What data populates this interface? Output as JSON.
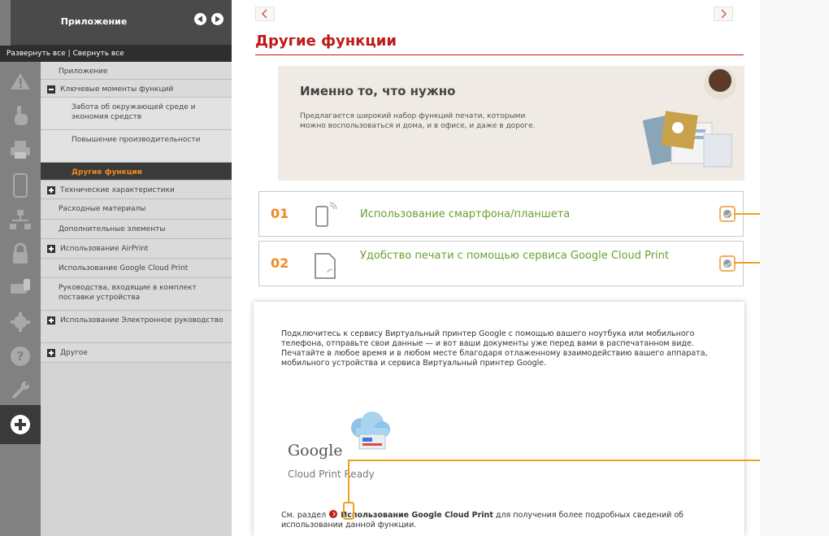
{
  "sidebar": {
    "title": "Приложение",
    "expand_all": "Развернуть все",
    "separator": " | ",
    "collapse_all": "Свернуть все",
    "tree": [
      {
        "label": "Приложение",
        "level": 1,
        "toggle": "none"
      },
      {
        "label": "Ключевые моменты функций",
        "level": 1,
        "toggle": "minus"
      },
      {
        "label": "Забота об окружающей среде и экономия средств",
        "level": 2,
        "toggle": "none"
      },
      {
        "label": "Повышение производительности",
        "level": 2,
        "toggle": "none"
      },
      {
        "label": "Другие функции",
        "level": 2,
        "toggle": "none",
        "selected": true
      },
      {
        "label": "Технические характеристики",
        "level": 1,
        "toggle": "plus"
      },
      {
        "label": "Расходные материалы",
        "level": 1,
        "toggle": "none"
      },
      {
        "label": "Дополнительные элементы",
        "level": 1,
        "toggle": "none"
      },
      {
        "label": "Использование AirPrint",
        "level": 1,
        "toggle": "plus"
      },
      {
        "label": "Использование Google Cloud Print",
        "level": 1,
        "toggle": "none"
      },
      {
        "label": "Руководства, входящие в комплект поставки устройства",
        "level": 1,
        "toggle": "none"
      },
      {
        "label": "Использование Электронное руководство",
        "level": 1,
        "toggle": "plus"
      },
      {
        "label": "Другое",
        "level": 1,
        "toggle": "plus"
      }
    ],
    "icons": [
      "warning-icon",
      "hand-touch-icon",
      "printer-icon",
      "smartphone-icon",
      "network-icon",
      "lock-icon",
      "mobile-print-icon",
      "gear-icon",
      "help-icon",
      "wrench-icon",
      "plus-circle-icon"
    ]
  },
  "main": {
    "title": "Другие функции",
    "banner": {
      "heading": "Именно то, что нужно",
      "text": "Предлагается широкий набор функций печати, которыми можно воспользоваться и дома, и в офисе, и даже в дороге."
    },
    "features": [
      {
        "number": "01",
        "label": "Использование смартфона/планшета",
        "icon": "smartphone-icon",
        "callout": "a"
      },
      {
        "number": "02",
        "label": "Удобство печати с помощью сервиса Google Cloud Print",
        "icon": "cloud-print-document-icon",
        "callout": "a"
      }
    ],
    "panel": {
      "text": "Подключитесь к сервису Виртуальный принтер Google с помощью вашего ноутбука или мобильного телефона, отправьте свои данные — и вот ваши документы уже перед вами в распечатанном виде. Печатайте в любое время и в любом месте благодаря отлаженному взаимодействию вашего аппарата, мобильного устройства и сервиса Виртуальный принтер Google.",
      "logo_google": "Google",
      "logo_cloud": "Cloud Print Ready",
      "see_prefix": "См. раздел",
      "see_link": "Использование Google Cloud Print",
      "see_suffix": "для получения более подробных сведений об использовании данной функции.",
      "callout": "b"
    }
  },
  "colors": {
    "accent_red": "#c01919",
    "accent_orange": "#f08a24",
    "link_green": "#6aa030"
  }
}
